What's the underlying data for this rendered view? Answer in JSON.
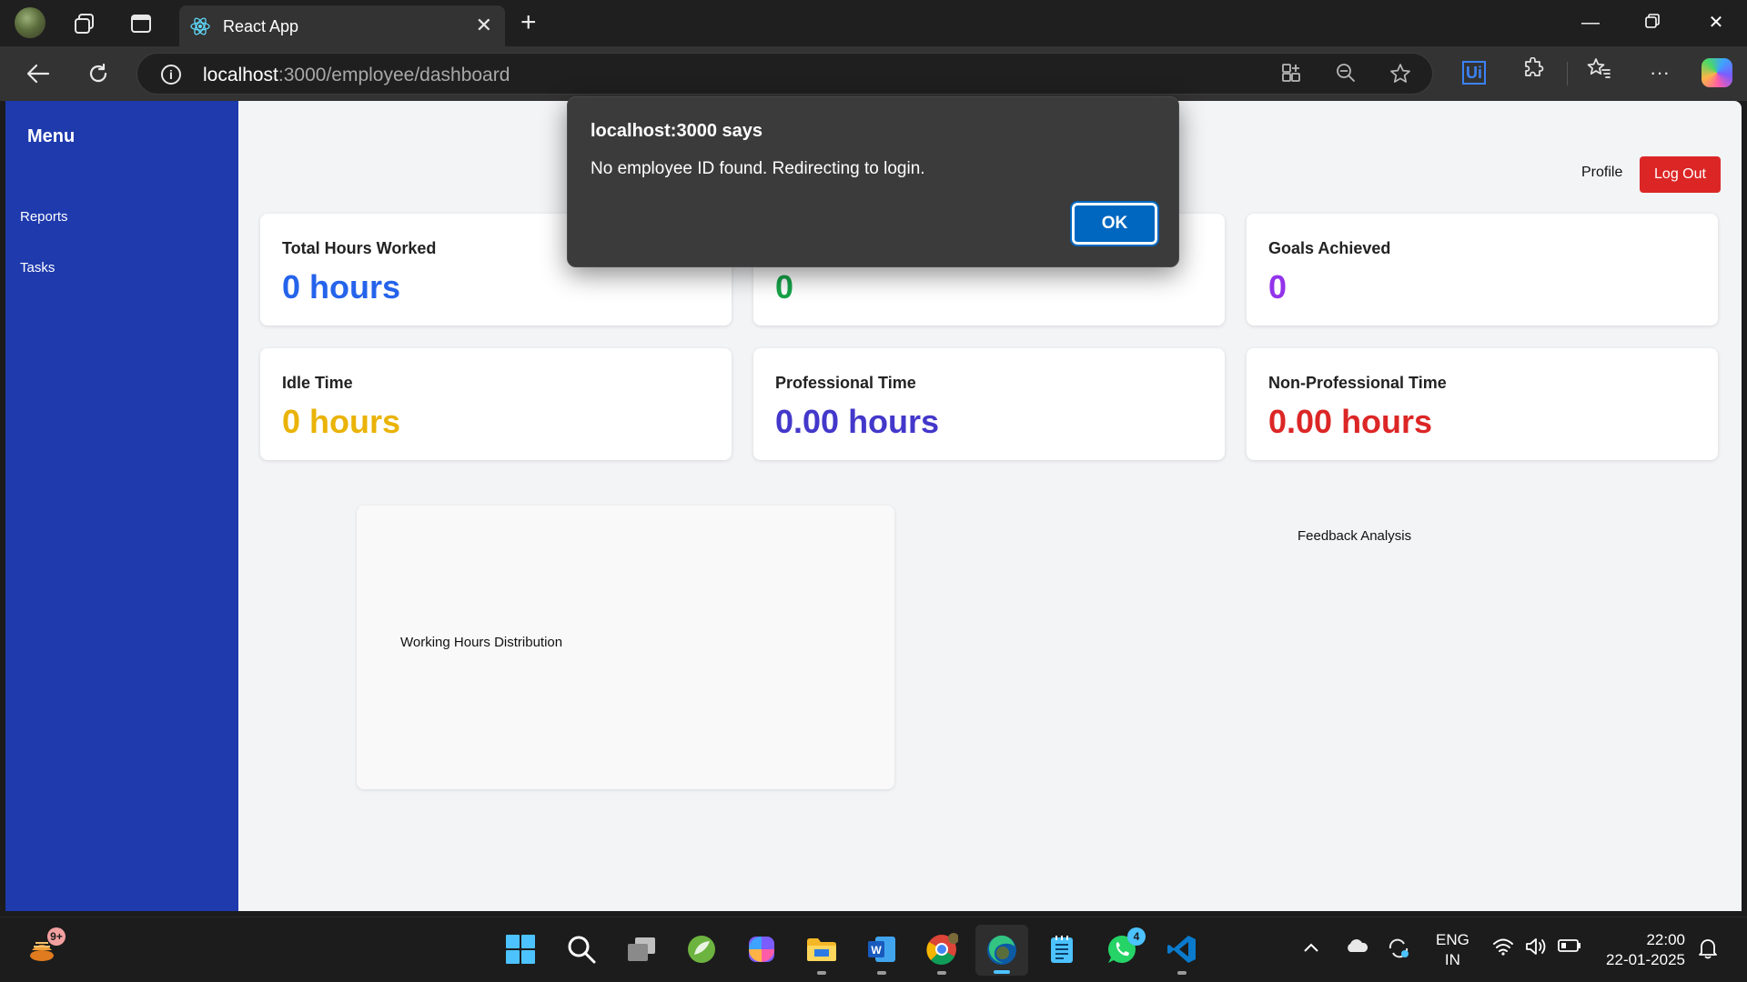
{
  "browser": {
    "tab_title": "React App",
    "url_host": "localhost",
    "url_rest": ":3000/employee/dashboard"
  },
  "sidebar": {
    "title": "Menu",
    "items": [
      {
        "label": "Reports"
      },
      {
        "label": "Tasks"
      }
    ]
  },
  "header": {
    "profile_label": "Profile",
    "logout_label": "Log Out"
  },
  "cards": [
    {
      "label": "Total Hours Worked",
      "value": "0 hours",
      "color": "#2563eb"
    },
    {
      "label": "",
      "value": "0",
      "color": "#16a34a"
    },
    {
      "label": "Goals Achieved",
      "value": "0",
      "color": "#9333ea"
    },
    {
      "label": "Idle Time",
      "value": "0 hours",
      "color": "#eab308"
    },
    {
      "label": "Professional Time",
      "value": "0.00 hours",
      "color": "#4338ca"
    },
    {
      "label": "Non-Professional Time",
      "value": "0.00 hours",
      "color": "#dc2626"
    }
  ],
  "charts": {
    "working_hours_label": "Working Hours Distribution",
    "feedback_label": "Feedback Analysis"
  },
  "dialog": {
    "title": "localhost:3000 says",
    "message": "No employee ID found. Redirecting to login.",
    "ok_label": "OK"
  },
  "taskbar": {
    "widget_badge": "9+",
    "whatsapp_badge": "4",
    "lang_line1": "ENG",
    "lang_line2": "IN",
    "time": "22:00",
    "date": "22-01-2025"
  }
}
